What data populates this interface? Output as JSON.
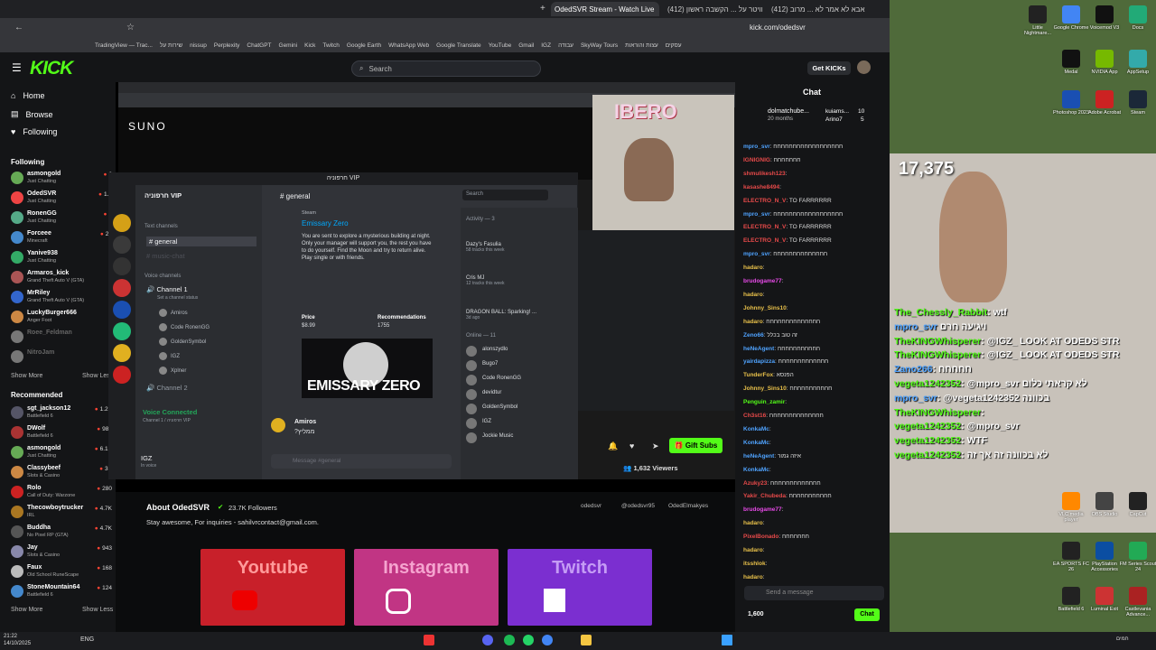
{
  "browser": {
    "tabs": [
      {
        "label": "OdedSVR Stream - Watch Live",
        "active": true
      },
      {
        "label": "(412) אנדי סקוויטר על ... הקשבה ראשון",
        "active": false
      },
      {
        "label": "(412) אבא לא אמר לא ... מרוב",
        "active": false
      }
    ],
    "url": "kick.com/odedsvr",
    "bookmarks": [
      "TradingView — Trac...",
      "שירות על",
      "nissup",
      "Perplexity",
      "ChatGPT",
      "Gemini",
      "Kick",
      "Twitch",
      "Google Earth",
      "WhatsApp Web",
      "Google Translate",
      "YouTube",
      "Gmail",
      "IGZ",
      "עבודה",
      "SkyWay Tours",
      "עצות והוראות",
      "עסקים"
    ]
  },
  "kick": {
    "logo": "KICK",
    "search_placeholder": "Search",
    "get_kicks": "Get KICKs",
    "nav": {
      "home": "Home",
      "browse": "Browse",
      "following": "Following"
    },
    "following_header": "Following",
    "following": [
      {
        "name": "asmongold",
        "game": "Just Chatting",
        "viewers": "6"
      },
      {
        "name": "OdedSVR",
        "game": "Just Chatting",
        "viewers": "1.6"
      },
      {
        "name": "RonenGG",
        "game": "Just Chatting",
        "viewers": "6"
      },
      {
        "name": "Forceee",
        "game": "Minecraft",
        "viewers": "22"
      },
      {
        "name": "Yanive938",
        "game": "Just Chatting",
        "viewers": ""
      },
      {
        "name": "Armaros_kick",
        "game": "Grand Theft Auto V (GTA)",
        "viewers": ""
      },
      {
        "name": "MrRiley",
        "game": "Grand Theft Auto V (GTA)",
        "viewers": ""
      },
      {
        "name": "LuckyBurger666",
        "game": "Anger Foot",
        "viewers": ""
      },
      {
        "name": "Roee_Feldman",
        "game": "",
        "viewers": "",
        "offline": true
      },
      {
        "name": "NitroJam",
        "game": "",
        "viewers": "",
        "offline": true
      }
    ],
    "show_more": "Show More",
    "show_less": "Show Less",
    "recommended_header": "Recommended",
    "recommended": [
      {
        "name": "sgt_jackson12",
        "game": "Battlefield 6",
        "viewers": "1.2K"
      },
      {
        "name": "DWolf",
        "game": "Battlefield 6",
        "viewers": "989"
      },
      {
        "name": "asmongold",
        "game": "Just Chatting",
        "viewers": "6.1K"
      },
      {
        "name": "Classybeef",
        "game": "Slots & Casino",
        "viewers": "3K"
      },
      {
        "name": "Rolo",
        "game": "Call of Duty: Warzone",
        "viewers": "280"
      },
      {
        "name": "Thecowboytrucker",
        "game": "IRL",
        "viewers": "4.7K"
      },
      {
        "name": "Buddha",
        "game": "No Pixel RP (GTA)",
        "viewers": "4.7K"
      },
      {
        "name": "Jay",
        "game": "Slots & Casino",
        "viewers": "943"
      },
      {
        "name": "Faux",
        "game": "Old School RuneScape",
        "viewers": "168"
      },
      {
        "name": "StoneMountain64",
        "game": "Battlefield 6",
        "viewers": "124"
      }
    ],
    "show_more2": "Show More",
    "show_less2": "Show Less",
    "gift_subs": "Gift Subs",
    "viewers": "1,632 Viewers",
    "about_title": "About OdedSVR",
    "followers": "23.7K Followers",
    "bio": "Stay awesome, For inquiries - sahilvrcontact@gmail.com.",
    "socials": [
      "odedsvr",
      "@odedsvr95",
      "OdedElmakyes"
    ],
    "banners": [
      {
        "label": "Youtube",
        "bg": "#c8202a"
      },
      {
        "label": "Instagram",
        "bg": "#c13584"
      },
      {
        "label": "Twitch",
        "bg": "#7b2fd0"
      }
    ]
  },
  "stream": {
    "suno_logo": "SUNO",
    "ibero": "IBERO",
    "discord": {
      "title": "חרפוניה VIP",
      "server_name": "חרפוניה VIP",
      "text_channels": "Text channels",
      "general": "general",
      "music_chat": "music-chat",
      "voice_channels": "Voice channels",
      "channel1": "Channel 1",
      "set_status": "Set a channel status",
      "voice_users": [
        "Amiros",
        "Code RonenGG",
        "GoldenSymbol",
        "IGZ",
        "Xplner"
      ],
      "channel2": "Channel 2",
      "voice_connected": "Voice Connected",
      "voice_sub": "Channel 1 / חרפוניה VIP",
      "user": "IGZ",
      "user_status": "In voice",
      "chat_header": "general",
      "search": "Search",
      "steam": "Steam",
      "game_title": "Emissary Zero",
      "game_desc": "You are sent to explore a mysterious building at night. Only your manager will support you, the rest you have to do yourself. Find the Moon and try to return alive. Play single or with friends.",
      "price_label": "Price",
      "price": "$8.99",
      "recs_label": "Recommendations",
      "recs": "1755",
      "game_banner": "EMISSARY ZERO",
      "msg_user": "Amiros",
      "msg_text": "?ממליץ",
      "message_placeholder": "Message #general",
      "activity_header": "Activity — 3",
      "activity": [
        {
          "name": "Dazy's Fasulia",
          "sub": "58 tracks this week"
        },
        {
          "name": "Cris MJ",
          "sub": "12 tracks this week"
        },
        {
          "name": "DRAGON BALL: Sparking! ...",
          "sub": "3d ago"
        }
      ],
      "online_header": "Online — 11",
      "online": [
        "alonszydlo",
        "Bugo7",
        "Code RonenGG",
        "devidtur",
        "GoldenSymbol",
        "IGZ",
        "Jockie Music"
      ]
    }
  },
  "overlay": {
    "viewer_count": "17,375",
    "messages": [
      {
        "user": "The_Chessly_Rabbit",
        "text": ": wtf",
        "color": "#53fc18"
      },
      {
        "user": "mpro_svr",
        "text": " ויגיעה חרם",
        "color": "#4fa3ff"
      },
      {
        "user": "TheKINGWhisperer",
        "text": ": @IGZ_ LOOK AT ODEDS STR",
        "color": "#53fc18"
      },
      {
        "user": "TheKINGWhisperer",
        "text": ": @IGZ_ LOOK AT ODEDS STR",
        "color": "#53fc18"
      },
      {
        "user": "Zano266",
        "text": ": חחחחח",
        "color": "#4fa3ff"
      },
      {
        "user": "vegeta1242352",
        "text": ": @mpro_svr לא קראתי כלום",
        "color": "#53fc18"
      },
      {
        "user": "mpro_svr",
        "text": ": @vegeta1242352 בכוונה",
        "color": "#4fa3ff"
      },
      {
        "user": "TheKINGWhisperer",
        "text": ":",
        "color": "#53fc18"
      },
      {
        "user": "vegeta1242352",
        "text": ": @mpro_svr",
        "color": "#53fc18"
      },
      {
        "user": "vegeta1242352",
        "text": ": WTF",
        "color": "#53fc18"
      },
      {
        "user": "vegeta1242352",
        "text": ": לא בכוונה זה אך זה",
        "color": "#53fc18"
      }
    ]
  },
  "chat": {
    "title": "Chat",
    "pinned_user": "dolmatchube...",
    "pinned_count": "20 months",
    "pinned_right": [
      "kuiams...",
      "Arino7"
    ],
    "pinned_nums": [
      "10",
      "5"
    ],
    "messages": [
      {
        "user": "mpro_svr",
        "text": ": חחחחחחחחחחחחחחחחחח",
        "color": "#4fa3ff"
      },
      {
        "user": "IGNIGNIG",
        "text": ": חחחחחחח",
        "color": "#e84a4a"
      },
      {
        "user": "shmulikesh123",
        "text": ": ",
        "color": "#e84a4a"
      },
      {
        "user": "kasashe8494",
        "text": ":",
        "color": "#e84a4a"
      },
      {
        "user": "ELECTRO_N_V",
        "text": ": TO FARRRRRR",
        "color": "#e84a4a"
      },
      {
        "user": "mpro_svr",
        "text": ": חחחחחחחחחחחחחחחחחח",
        "color": "#4fa3ff"
      },
      {
        "user": "ELECTRO_N_V",
        "text": ": TO FARRRRRR",
        "color": "#e84a4a"
      },
      {
        "user": "ELECTRO_N_V",
        "text": ": TO FARRRRRR",
        "color": "#e84a4a"
      },
      {
        "user": "mpro_svr",
        "text": ": חחחחחחחחחחחחחח",
        "color": "#4fa3ff"
      },
      {
        "user": "hadaro",
        "text": ":",
        "color": "#e8c04a"
      },
      {
        "user": "brudogame77",
        "text": ":",
        "color": "#e84ae8"
      },
      {
        "user": "hadaro",
        "text": ":",
        "color": "#e8c04a"
      },
      {
        "user": "Johnny_Sins10",
        "text": ":",
        "color": "#e8c04a"
      },
      {
        "user": "hadaro",
        "text": ": חחחחחחחחחחחחחח",
        "color": "#e8c04a"
      },
      {
        "user": "Zeno66",
        "text": ": זה טוב בכלל",
        "color": "#4fa3ff"
      },
      {
        "user": "heNeAgent",
        "text": ": חחחחחחחחחחח",
        "color": "#4fa3ff"
      },
      {
        "user": "yairdapizza",
        "text": ": חחחחחחחחחחחחח",
        "color": "#4fa3ff"
      },
      {
        "user": "TunderFox",
        "text": ": הפנסא",
        "color": "#e8c04a"
      },
      {
        "user": "Johnny_Sins10",
        "text": ": חחחחחחחחחחח",
        "color": "#e8c04a"
      },
      {
        "user": "Penguin_zamir",
        "text": ":",
        "color": "#53fc18"
      },
      {
        "user": "Ch3st16",
        "text": ": חחחחחחחחחחחחחח",
        "color": "#e84a4a"
      },
      {
        "user": "KonkaMc",
        "text": ":",
        "color": "#4fa3ff"
      },
      {
        "user": "KonkaMc",
        "text": ":",
        "color": "#4fa3ff"
      },
      {
        "user": "heNeAgent",
        "text": ": איזה גמור",
        "color": "#4fa3ff"
      },
      {
        "user": "KonkaMc",
        "text": ":",
        "color": "#4fa3ff"
      },
      {
        "user": "Azuky23",
        "text": ": חחחחחחחחחחחחח",
        "color": "#e84a4a"
      },
      {
        "user": "Yakir_Chubeda",
        "text": ": חחחחחחחחחחח",
        "color": "#e84a4a"
      },
      {
        "user": "brudogame77",
        "text": ":",
        "color": "#e84ae8"
      },
      {
        "user": "hadaro",
        "text": ":",
        "color": "#e8c04a"
      },
      {
        "user": "PixelBonado",
        "text": ": חחחחחחח",
        "color": "#e84a4a"
      },
      {
        "user": "hadaro",
        "text": ":",
        "color": "#e8c04a"
      },
      {
        "user": "itsshlok",
        "text": ":",
        "color": "#e8c04a"
      },
      {
        "user": "hadaro",
        "text": ":",
        "color": "#e8c04a"
      }
    ],
    "input_placeholder": "Send a message",
    "points": "1,600",
    "send": "Chat"
  },
  "desktop": {
    "icons": [
      "Little Nightmare...",
      "Google Chrome",
      "Voicemod V3",
      "Docs",
      "Medal",
      "NVIDIA App",
      "AppSetup",
      "Photoshop 2023",
      "Adobe Acrobat",
      "Steam",
      "VLC media player",
      "OBS Studio",
      "CapCut",
      "EA SPORTS FC 26",
      "PlayStation Accessories",
      "FM Series Scout 24",
      "Battlefield 6",
      "Luminal Exit",
      "Castlevania Advance..."
    ],
    "clock_time": "21:22",
    "clock_date": "14/10/2025",
    "lang": "ENG",
    "weather": "חמים"
  }
}
